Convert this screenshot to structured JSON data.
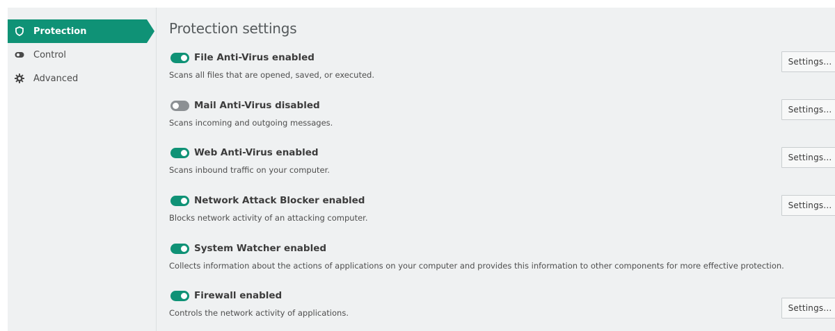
{
  "sidebar": {
    "items": [
      {
        "label": "Protection",
        "icon": "shield-icon",
        "active": true
      },
      {
        "label": "Control",
        "icon": "toggle-icon",
        "active": false
      },
      {
        "label": "Advanced",
        "icon": "gear-icon",
        "active": false
      }
    ]
  },
  "main": {
    "title": "Protection settings",
    "settings_label": "Settings...",
    "components": [
      {
        "title": "File Anti-Virus enabled",
        "description": "Scans all files that are opened, saved, or executed.",
        "enabled": true,
        "has_settings": true
      },
      {
        "title": "Mail Anti-Virus disabled",
        "description": "Scans incoming and outgoing messages.",
        "enabled": false,
        "has_settings": true
      },
      {
        "title": "Web Anti-Virus enabled",
        "description": "Scans inbound traffic on your computer.",
        "enabled": true,
        "has_settings": true
      },
      {
        "title": "Network Attack Blocker enabled",
        "description": "Blocks network activity of an attacking computer.",
        "enabled": true,
        "has_settings": true
      },
      {
        "title": "System Watcher enabled",
        "description": "Collects information about the actions of applications on your computer and provides this information to other components for more effective protection.",
        "enabled": true,
        "has_settings": false
      },
      {
        "title": "Firewall enabled",
        "description": "Controls the network activity of applications.",
        "enabled": true,
        "has_settings": true
      }
    ]
  },
  "colors": {
    "accent": "#0f9276",
    "toggle_off": "#8c9093",
    "panel_bg": "#eff1f2"
  }
}
